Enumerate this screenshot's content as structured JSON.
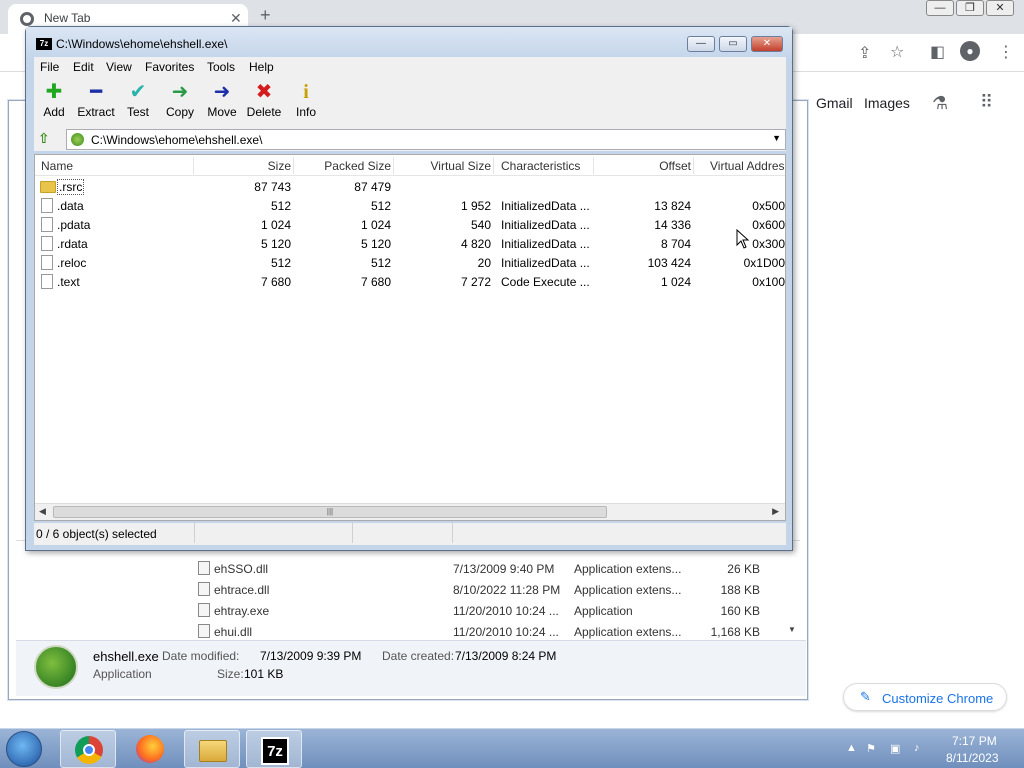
{
  "chrome": {
    "tab_title": "New Tab",
    "gmail": "Gmail",
    "images": "Images",
    "customize": "Customize Chrome"
  },
  "explorer": {
    "rows": [
      {
        "name": "ehSSO.dll",
        "date": "7/13/2009 9:40 PM",
        "type": "Application extens...",
        "size": "26 KB"
      },
      {
        "name": "ehtrace.dll",
        "date": "8/10/2022 11:28 PM",
        "type": "Application extens...",
        "size": "188 KB"
      },
      {
        "name": "ehtray.exe",
        "date": "11/20/2010 10:24 ...",
        "type": "Application",
        "size": "160 KB"
      },
      {
        "name": "ehui.dll",
        "date": "11/20/2010 10:24 ...",
        "type": "Application extens...",
        "size": "1,168 KB"
      }
    ],
    "details": {
      "filename": "ehshell.exe",
      "modified_label": "Date modified:",
      "modified": "7/13/2009 9:39 PM",
      "created_label": "Date created:",
      "created": "7/13/2009 8:24 PM",
      "type": "Application",
      "size_label": "Size:",
      "size": "101 KB"
    }
  },
  "zip": {
    "title": "C:\\Windows\\ehome\\ehshell.exe\\",
    "icon_text": "7z",
    "menu": [
      "File",
      "Edit",
      "View",
      "Favorites",
      "Tools",
      "Help"
    ],
    "toolbar": [
      {
        "label": "Add",
        "icon": "add-icon",
        "glyph": "✚",
        "color": "#1fa81f"
      },
      {
        "label": "Extract",
        "icon": "extract-icon",
        "glyph": "━",
        "color": "#1c2fa8"
      },
      {
        "label": "Test",
        "icon": "test-icon",
        "glyph": "✔",
        "color": "#2ab3a8"
      },
      {
        "label": "Copy",
        "icon": "copy-icon",
        "glyph": "➜",
        "color": "#2a9a48"
      },
      {
        "label": "Move",
        "icon": "move-icon",
        "glyph": "➜",
        "color": "#1c2fa8"
      },
      {
        "label": "Delete",
        "icon": "delete-icon",
        "glyph": "✖",
        "color": "#d41c1c"
      },
      {
        "label": "Info",
        "icon": "info-icon",
        "glyph": "i",
        "color": "#c8a000"
      }
    ],
    "path": "C:\\Windows\\ehome\\ehshell.exe\\",
    "columns": [
      "Name",
      "Size",
      "Packed Size",
      "Virtual Size",
      "Characteristics",
      "Offset",
      "Virtual Addres"
    ],
    "rows": [
      {
        "name": ".rsrc",
        "size": "87 743",
        "packed": "87 479",
        "vsize": "",
        "chars": "",
        "offset": "",
        "vaddr": "",
        "folder": true
      },
      {
        "name": ".data",
        "size": "512",
        "packed": "512",
        "vsize": "1 952",
        "chars": "InitializedData ...",
        "offset": "13 824",
        "vaddr": "0x500",
        "folder": false
      },
      {
        "name": ".pdata",
        "size": "1 024",
        "packed": "1 024",
        "vsize": "540",
        "chars": "InitializedData ...",
        "offset": "14 336",
        "vaddr": "0x600",
        "folder": false
      },
      {
        "name": ".rdata",
        "size": "5 120",
        "packed": "5 120",
        "vsize": "4 820",
        "chars": "InitializedData ...",
        "offset": "8 704",
        "vaddr": "0x300",
        "folder": false
      },
      {
        "name": ".reloc",
        "size": "512",
        "packed": "512",
        "vsize": "20",
        "chars": "InitializedData ...",
        "offset": "103 424",
        "vaddr": "0x1D00",
        "folder": false
      },
      {
        "name": ".text",
        "size": "7 680",
        "packed": "7 680",
        "vsize": "7 272",
        "chars": "Code Execute ...",
        "offset": "1 024",
        "vaddr": "0x100",
        "folder": false
      }
    ],
    "status": "0 / 6 object(s) selected"
  },
  "taskbar": {
    "time": "7:17 PM",
    "date": "8/11/2023",
    "zip_label": "7z"
  }
}
